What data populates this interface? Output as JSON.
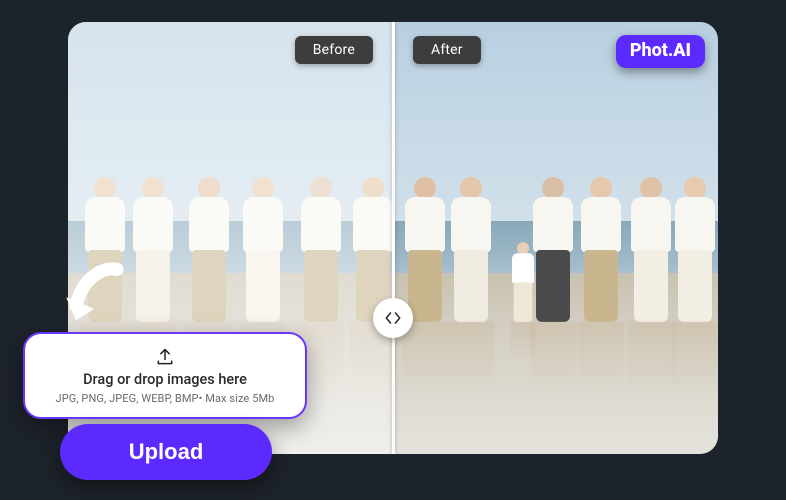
{
  "comparison": {
    "before_label": "Before",
    "after_label": "After"
  },
  "brand": {
    "part1": "Phot",
    "dot": ".",
    "part2": "AI"
  },
  "dropzone": {
    "main_text": "Drag or drop images here",
    "sub_text": "JPG, PNG, JPEG, WEBP, BMP• Max size 5Mb"
  },
  "actions": {
    "upload_label": "Upload"
  },
  "colors": {
    "accent": "#5c29ff"
  }
}
